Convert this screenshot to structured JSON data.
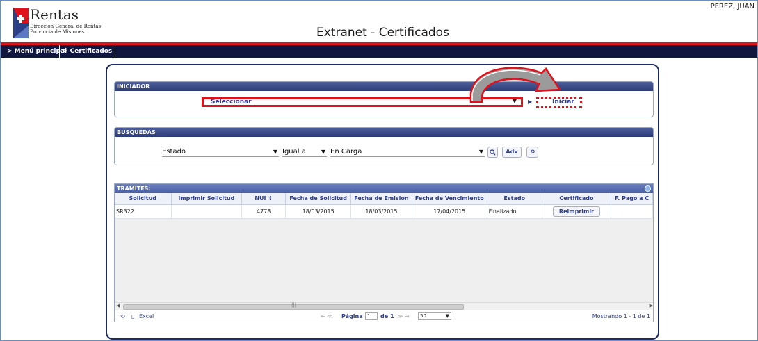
{
  "header": {
    "logo_title": "Rentas",
    "logo_sub1": "Dirección General de Rentas",
    "logo_sub2": "Provincia de Misiones",
    "app_title": "Extranet - Certificados",
    "user": "PEREZ, JUAN",
    "accent_color": "#e0111b",
    "nav_color": "#10163e"
  },
  "nav": {
    "menu": "> Menú principal",
    "certificados": "> Certificados"
  },
  "iniciador": {
    "title": "INICIADOR",
    "select_value": "Seleccionar",
    "button": "Iniciar"
  },
  "busquedas": {
    "title": "BUSQUEDAS",
    "campo": "Estado",
    "operador": "Igual a",
    "valor": "En Carga",
    "adv": "Adv"
  },
  "tramites": {
    "title": "TRAMITES:",
    "columns": [
      "Solicitud",
      "Imprimir Solicitud",
      "NUI ⇕",
      "Fecha de Solicitud",
      "Fecha de Emision",
      "Fecha de Vencimiento",
      "Estado",
      "Certificado",
      "F. Pago a C"
    ],
    "rows": [
      {
        "solicitud": "SR322",
        "imprimir": "",
        "nui": "4778",
        "fecha_solicitud": "18/03/2015",
        "fecha_emision": "18/03/2015",
        "fecha_vencimiento": "17/04/2015",
        "estado": "Finalizado",
        "certificado": "Reimprimir",
        "f_pago": ""
      }
    ]
  },
  "pager": {
    "excel": "Excel",
    "pagina": "Página",
    "page": "1",
    "of": "de 1",
    "page_size": "50",
    "info": "Mostrando 1 - 1 de 1"
  }
}
